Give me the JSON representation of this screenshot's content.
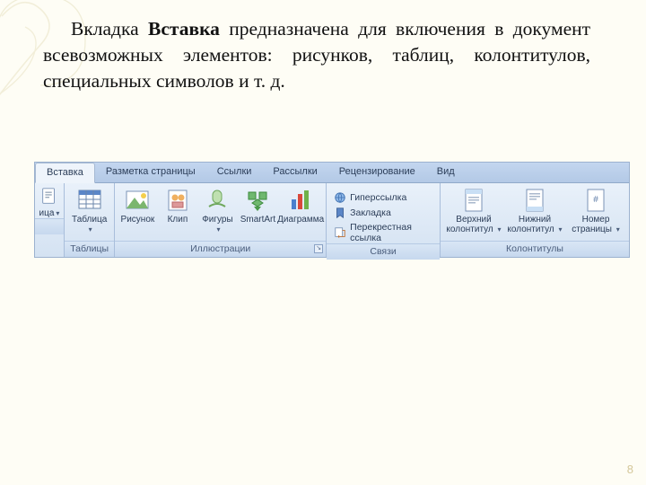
{
  "description": {
    "pre": "Вкладка",
    "bold": "Вставка",
    "post": "предназначена для включения в документ всевозможных элементов: рисунков, таблиц, колонтитулов, специальных символов и т. д."
  },
  "page_number": "8",
  "ribbon": {
    "tabs": [
      "Вставка",
      "Разметка страницы",
      "Ссылки",
      "Рассылки",
      "Рецензирование",
      "Вид"
    ],
    "active_tab": "Вставка",
    "edge_left": {
      "label": "ица",
      "has_dropdown": true
    },
    "groups": {
      "tables": {
        "title": "Таблицы",
        "item": {
          "label": "Таблица",
          "has_dropdown": true
        }
      },
      "illustrations": {
        "title": "Иллюстрации",
        "items": [
          {
            "label": "Рисунок"
          },
          {
            "label": "Клип"
          },
          {
            "label": "Фигуры",
            "has_dropdown": true
          },
          {
            "label": "SmartArt"
          },
          {
            "label": "Диаграмма"
          }
        ]
      },
      "links": {
        "title": "Связи",
        "items": [
          "Гиперссылка",
          "Закладка",
          "Перекрестная ссылка"
        ]
      },
      "headerfooter": {
        "title": "Колонтитулы",
        "items": [
          {
            "line1": "Верхний",
            "line2": "колонтитул",
            "has_dropdown": true
          },
          {
            "line1": "Нижний",
            "line2": "колонтитул",
            "has_dropdown": true
          },
          {
            "line1": "Номер",
            "line2": "страницы",
            "has_dropdown": true
          }
        ]
      }
    }
  }
}
